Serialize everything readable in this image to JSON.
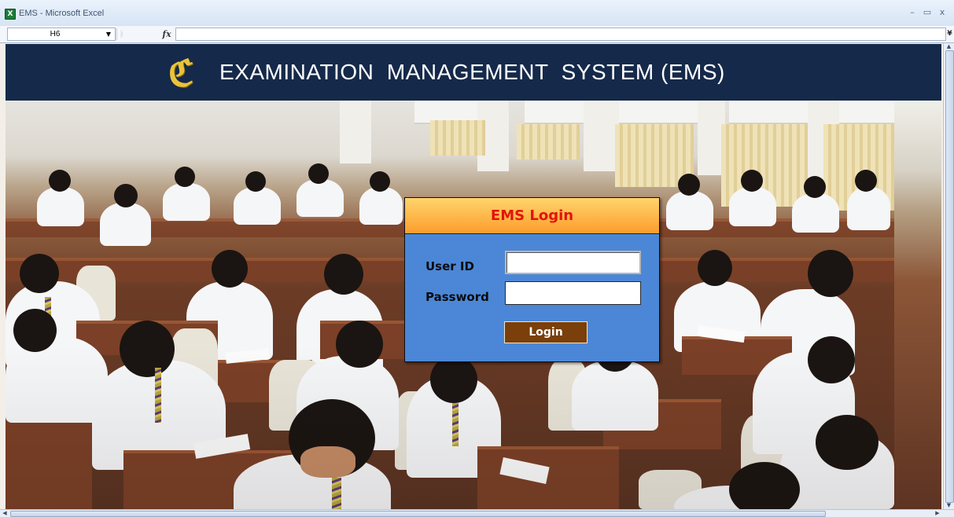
{
  "window": {
    "title": "EMS - Microsoft Excel",
    "app_icon_label": "X",
    "minimize_glyph": "–",
    "restore_glyph": "▭",
    "close_glyph": "x"
  },
  "formula_bar": {
    "name_box_value": "H6",
    "name_box_arrow": "▼",
    "fx_label": "fx",
    "formula_value": "",
    "expand_glyph": "¥"
  },
  "header": {
    "logo_glyph": "ℭ",
    "title": "EXAMINATION  MANAGEMENT  SYSTEM (EMS)",
    "background_color": "#15294a"
  },
  "login": {
    "title": "EMS Login",
    "user_id_label": "User ID",
    "password_label": "Password",
    "user_id_value": "",
    "password_value": "",
    "button_label": "Login",
    "colors": {
      "panel": "#4b87d6",
      "header_top": "#ffd46c",
      "header_bottom": "#fc9d2c",
      "title": "#e3130a",
      "button": "#7a3f0a"
    }
  },
  "scrollbars": {
    "up_glyph": "▲",
    "down_glyph": "▼",
    "left_glyph": "◀",
    "right_glyph": "▶"
  }
}
